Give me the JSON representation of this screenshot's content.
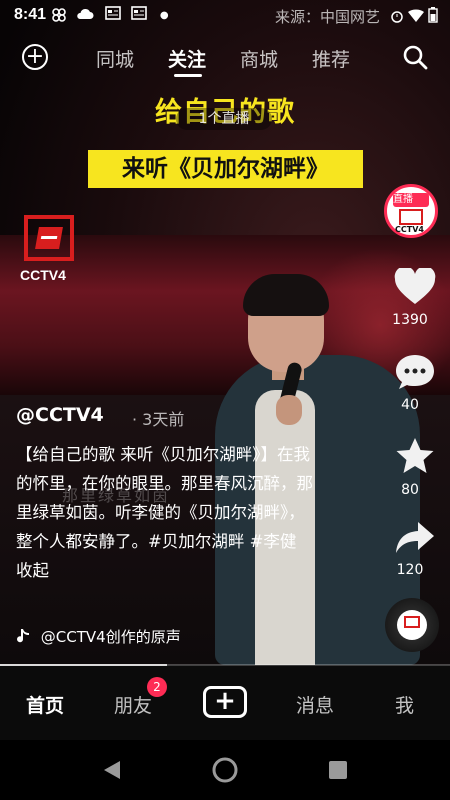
{
  "status_bar": {
    "time": "8:41",
    "source": "来源：中国网艺"
  },
  "top_nav": {
    "tabs": [
      {
        "label": "同城"
      },
      {
        "label": "关注"
      },
      {
        "label": "商城"
      },
      {
        "label": "推荐"
      }
    ],
    "active_tab": "关注"
  },
  "video": {
    "title_line1": "给自己的歌",
    "title_line2": "来听《贝加尔湖畔》",
    "live_pill": "1个直播",
    "channel_logo_text": "CCTV4",
    "watermark_subtitle": "那里绿草如茵"
  },
  "right_rail": {
    "live_label": "直播",
    "avatar_text": "CCTV4",
    "likes": "1390",
    "comments": "40",
    "favorites": "80",
    "shares": "120"
  },
  "post": {
    "author": "@CCTV4",
    "time_ago": "· 3天前",
    "caption": "【给自己的歌 来听《贝加尔湖畔》】在我的怀里，在你的眼里。那里春风沉醉，那里绿草如茵。听李健的《贝加尔湖畔》，整个人都安静了。#贝加尔湖畔 #李健  收起",
    "music": "@CCTV4创作的原声",
    "progress_fraction": 0.37
  },
  "bottom_nav": {
    "home": "首页",
    "friends": "朋友",
    "friends_badge": "2",
    "create": "+",
    "messages": "消息",
    "me": "我"
  },
  "colors": {
    "accent": "#fe2c55",
    "title_yellow": "#f7e51f",
    "cctv_red": "#d81e1e"
  }
}
